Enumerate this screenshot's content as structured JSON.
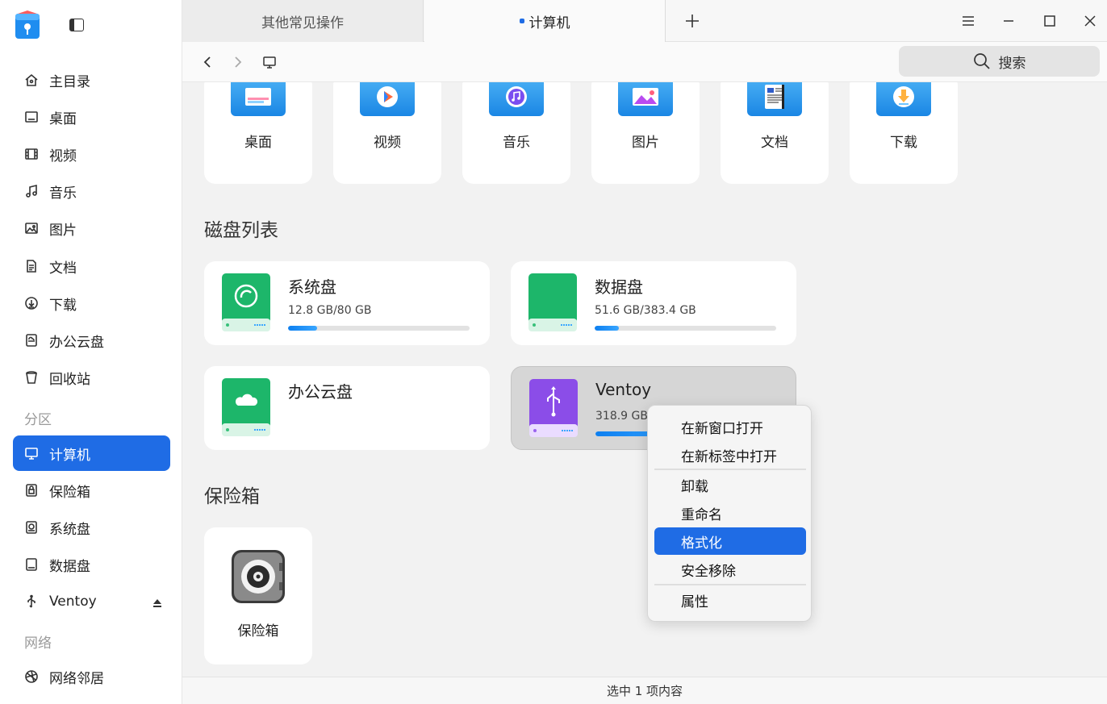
{
  "tabs": [
    {
      "label": "其他常见操作",
      "active": false
    },
    {
      "label": "计算机",
      "active": true
    }
  ],
  "titlebar": {
    "add_tab_icon": "plus-icon",
    "menu_icon": "hamburger-icon",
    "minimize_icon": "minimize-icon",
    "maximize_icon": "maximize-icon",
    "close_icon": "close-icon"
  },
  "toolbar": {
    "back_icon": "chevron-left-icon",
    "forward_icon": "chevron-right-icon",
    "location_icon": "computer-icon",
    "search_label": "搜索"
  },
  "sidebar": {
    "items": [
      {
        "label": "主目录",
        "icon": "home-icon"
      },
      {
        "label": "桌面",
        "icon": "desktop-icon"
      },
      {
        "label": "视频",
        "icon": "film-icon"
      },
      {
        "label": "音乐",
        "icon": "music-icon"
      },
      {
        "label": "图片",
        "icon": "image-icon"
      },
      {
        "label": "文档",
        "icon": "document-icon"
      },
      {
        "label": "下载",
        "icon": "download-icon"
      },
      {
        "label": "办公云盘",
        "icon": "cloud-disk-icon"
      },
      {
        "label": "回收站",
        "icon": "trash-icon"
      }
    ],
    "group_partition": "分区",
    "partitions": [
      {
        "label": "计算机",
        "icon": "computer-icon",
        "active": true
      },
      {
        "label": "保险箱",
        "icon": "lock-icon"
      },
      {
        "label": "系统盘",
        "icon": "system-disk-icon"
      },
      {
        "label": "数据盘",
        "icon": "disk-icon"
      },
      {
        "label": "Ventoy",
        "icon": "usb-icon",
        "eject_icon": "eject-icon"
      }
    ],
    "group_network": "网络",
    "network": [
      {
        "label": "网络邻居",
        "icon": "network-icon"
      }
    ]
  },
  "libraries": [
    {
      "label": "桌面",
      "icon": "desktop-folder-icon"
    },
    {
      "label": "视频",
      "icon": "video-folder-icon"
    },
    {
      "label": "音乐",
      "icon": "music-folder-icon"
    },
    {
      "label": "图片",
      "icon": "picture-folder-icon"
    },
    {
      "label": "文档",
      "icon": "document-folder-icon"
    },
    {
      "label": "下载",
      "icon": "download-folder-icon"
    }
  ],
  "disk_section_title": "磁盘列表",
  "disks": [
    {
      "name": "系统盘",
      "usage": "12.8 GB/80 GB",
      "fraction": 0.16,
      "color": "#1db66a",
      "icon": "system-disk-icon"
    },
    {
      "name": "数据盘",
      "usage": "51.6 GB/383.4 GB",
      "fraction": 0.135,
      "color": "#1db66a",
      "icon": "data-disk-icon"
    },
    {
      "name": "办公云盘",
      "usage": "",
      "fraction": null,
      "color": "#1db66a",
      "icon": "cloud-disk-icon"
    },
    {
      "name": "Ventoy",
      "usage": "318.9 GB/",
      "fraction": 0.5,
      "color": "#8b4de8",
      "icon": "usb-disk-icon",
      "selected": true
    }
  ],
  "vault_section_title": "保险箱",
  "vault": {
    "label": "保险箱",
    "icon": "vault-icon"
  },
  "status": "选中 1 项内容",
  "context_menu": [
    {
      "label": "在新窗口打开"
    },
    {
      "label": "在新标签中打开"
    },
    {
      "label": "卸载"
    },
    {
      "label": "重命名"
    },
    {
      "label": "格式化",
      "highlighted": true
    },
    {
      "label": "安全移除"
    },
    {
      "label": "属性"
    }
  ]
}
